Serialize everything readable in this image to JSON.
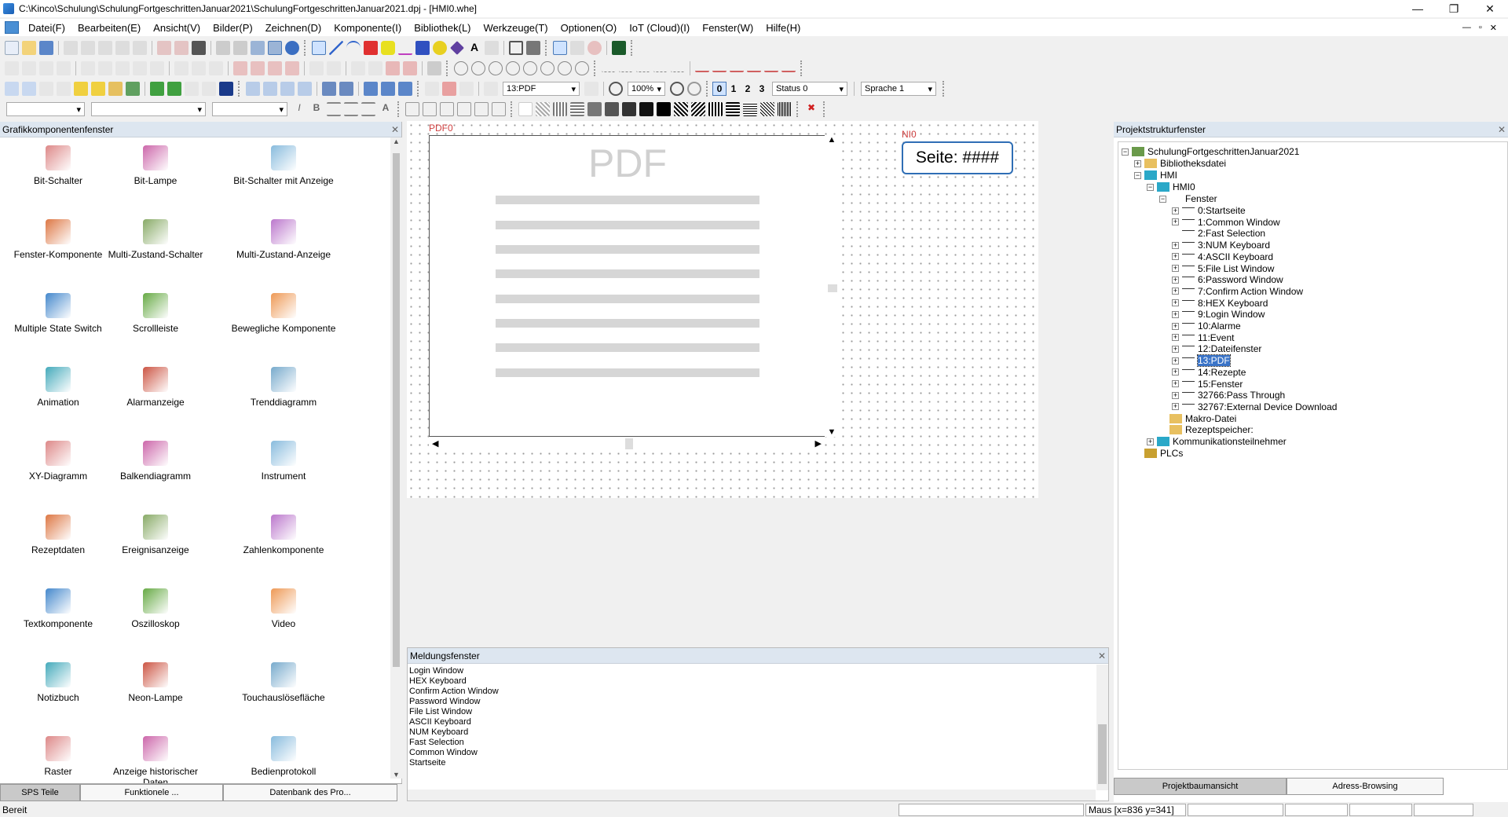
{
  "window": {
    "title": "C:\\Kinco\\Schulung\\SchulungFortgeschrittenJanuar2021\\SchulungFortgeschrittenJanuar2021.dpj - [HMI0.whe]",
    "min": "—",
    "max": "❐",
    "close": "✕"
  },
  "menu": {
    "items": [
      "Datei(F)",
      "Bearbeiten(E)",
      "Ansicht(V)",
      "Bilder(P)",
      "Zeichnen(D)",
      "Komponente(I)",
      "Bibliothek(L)",
      "Werkzeuge(T)",
      "Optionen(O)",
      "IoT (Cloud)(I)",
      "Fenster(W)",
      "Hilfe(H)"
    ],
    "child_min": "—",
    "child_max": "▫",
    "child_close": "✕"
  },
  "toolbar": {
    "screen_select": "13:PDF",
    "zoom": "100%",
    "state_buttons": [
      "0",
      "1",
      "2",
      "3"
    ],
    "status_select": "Status 0",
    "language_select": "Sprache 1"
  },
  "left_panel": {
    "title": "Grafikkomponentenfenster",
    "components": [
      {
        "label": "Bit-Schalter",
        "icon": "bit-switch-icon"
      },
      {
        "label": "Bit-Lampe",
        "icon": "bit-lamp-icon"
      },
      {
        "label": "Bit-Schalter mit Anzeige",
        "icon": "bit-switch-display-icon"
      },
      {
        "label": "Fenster-Komponente",
        "icon": "window-component-icon"
      },
      {
        "label": "Multi-Zustand-Schalter",
        "icon": "multi-state-switch-icon"
      },
      {
        "label": "Multi-Zustand-Anzeige",
        "icon": "multi-state-display-icon"
      },
      {
        "label": "Multiple State Switch",
        "icon": "multiple-state-switch-icon"
      },
      {
        "label": "Scrollleiste",
        "icon": "scrollbar-icon"
      },
      {
        "label": "Bewegliche Komponente",
        "icon": "moving-component-icon"
      },
      {
        "label": "Animation",
        "icon": "animation-icon"
      },
      {
        "label": "Alarmanzeige",
        "icon": "alarm-display-icon"
      },
      {
        "label": "Trenddiagramm",
        "icon": "trend-chart-icon"
      },
      {
        "label": "XY-Diagramm",
        "icon": "xy-chart-icon"
      },
      {
        "label": "Balkendiagramm",
        "icon": "bar-chart-icon"
      },
      {
        "label": "Instrument",
        "icon": "gauge-icon"
      },
      {
        "label": "Rezeptdaten",
        "icon": "recipe-icon"
      },
      {
        "label": "Ereignisanzeige",
        "icon": "event-display-icon"
      },
      {
        "label": "Zahlenkomponente",
        "icon": "number-component-icon"
      },
      {
        "label": "Textkomponente",
        "icon": "text-component-icon"
      },
      {
        "label": "Oszilloskop",
        "icon": "oscilloscope-icon"
      },
      {
        "label": "Video",
        "icon": "video-icon"
      },
      {
        "label": "Notizbuch",
        "icon": "notebook-icon"
      },
      {
        "label": "Neon-Lampe",
        "icon": "neon-lamp-icon"
      },
      {
        "label": "Touchauslösefläche",
        "icon": "touch-area-icon"
      },
      {
        "label": "Raster",
        "icon": "grid-icon"
      },
      {
        "label": "Anzeige historischer Daten",
        "icon": "history-data-icon"
      },
      {
        "label": "Bedienprotokoll",
        "icon": "operation-log-icon"
      }
    ],
    "tabs": [
      "SPS Teile",
      "Funktionele ...",
      "Datenbank des Pro..."
    ]
  },
  "canvas": {
    "pdf_label": "PDF0",
    "pdf_placeholder": "PDF",
    "ni_label": "NI0",
    "ni_text": "Seite: ####"
  },
  "message_panel": {
    "title": "Meldungsfenster",
    "lines": [
      "Login Window",
      "HEX Keyboard",
      "Confirm Action Window",
      "Password Window",
      "File List Window",
      "ASCII Keyboard",
      "NUM Keyboard",
      "Fast Selection",
      "Common Window",
      "Startseite"
    ]
  },
  "right_panel": {
    "title": "Projektstrukturfenster",
    "tree": {
      "root": "SchulungFortgeschrittenJanuar2021",
      "library": "Bibliotheksdatei",
      "hmi": "HMI",
      "hmi0": "HMI0",
      "fenster": "Fenster",
      "windows": [
        "0:Startseite",
        "1:Common Window",
        "2:Fast Selection",
        "3:NUM Keyboard",
        "4:ASCII Keyboard",
        "5:File List Window",
        "6:Password Window",
        "7:Confirm Action Window",
        "8:HEX Keyboard",
        "9:Login Window",
        "10:Alarme",
        "11:Event",
        "12:Dateifenster",
        "13:PDF",
        "14:Rezepte",
        "15:Fenster",
        "32766:Pass Through",
        "32767:External Device Download"
      ],
      "macro": "Makro-Datei",
      "recipe": "Rezeptspeicher:",
      "comm": "Kommunikationsteilnehmer",
      "plcs": "PLCs"
    },
    "tabs": [
      "Projektbaumansicht",
      "Adress-Browsing"
    ]
  },
  "status": {
    "ready": "Bereit",
    "mouse": "Maus [x=836  y=341]"
  }
}
